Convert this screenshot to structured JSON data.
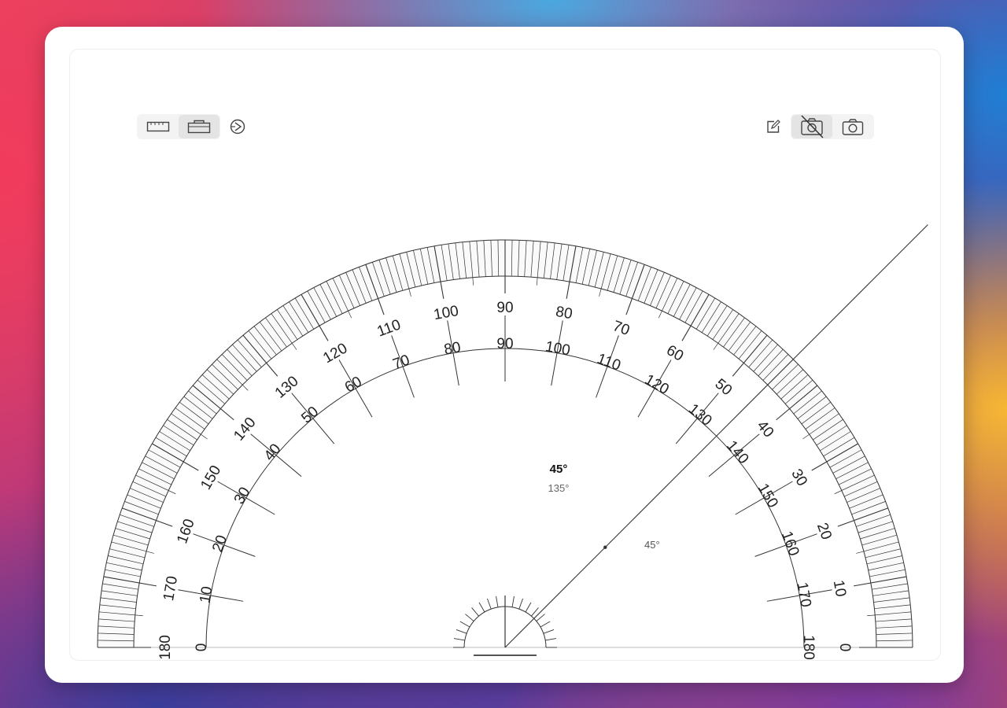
{
  "toolbar": {
    "left": [
      {
        "name": "ruler-mode-button",
        "icon": "ruler-icon",
        "active": false
      },
      {
        "name": "protractor-mode-button",
        "icon": "protractor-icon",
        "active": true
      },
      {
        "name": "theme-button",
        "icon": "theme-icon",
        "active": false
      }
    ],
    "right": [
      {
        "name": "edit-button",
        "icon": "edit-icon",
        "active": false
      },
      {
        "name": "camera-off-button",
        "icon": "camera-off-icon",
        "active": true
      },
      {
        "name": "camera-button",
        "icon": "camera-icon",
        "active": false
      }
    ]
  },
  "readout": {
    "primary": "45°",
    "secondary": "135°"
  },
  "measure_line": {
    "angle_deg": 45,
    "label": "45°"
  },
  "protractor": {
    "outer_major_labels": [
      "0",
      "10",
      "20",
      "30",
      "40",
      "50",
      "60",
      "70",
      "80",
      "90",
      "100",
      "110",
      "120",
      "130",
      "140",
      "150",
      "160",
      "170",
      "180"
    ],
    "inner_major_labels": [
      "180",
      "170",
      "160",
      "150",
      "140",
      "130",
      "120",
      "110",
      "100",
      "90",
      "80",
      "70",
      "60",
      "50",
      "40",
      "30",
      "20",
      "10",
      "0"
    ],
    "colors": {
      "stroke": "#333333",
      "label": "#222222",
      "band_fill": "#fafafa"
    }
  }
}
